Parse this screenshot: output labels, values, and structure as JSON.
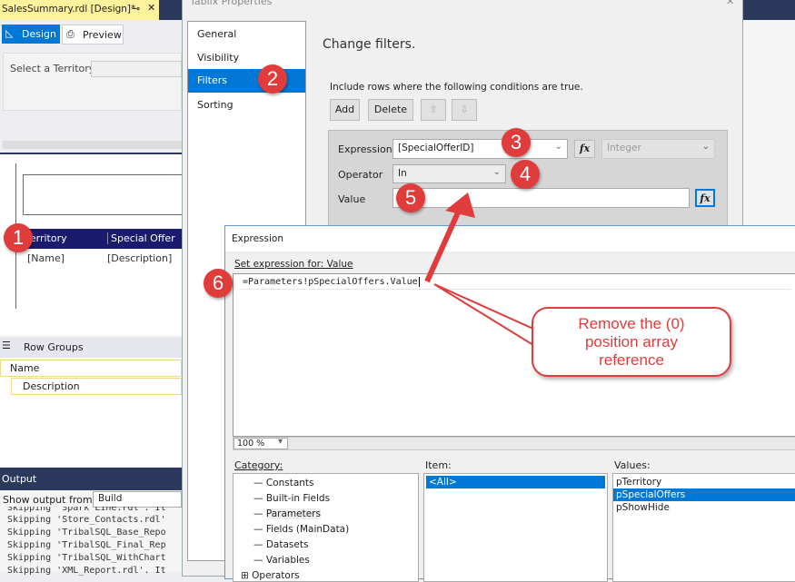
{
  "vs": {
    "doc_tab": "SalesSummary.rdl [Design]*",
    "design_tab": "Design",
    "preview_tab": "Preview",
    "param_label": "Select a Territory",
    "table": {
      "headers": [
        "Territory",
        "Special Offer"
      ],
      "cells": [
        "[Name]",
        "[Description]"
      ]
    },
    "row_groups": {
      "title": "Row Groups",
      "items": [
        "Name",
        "Description"
      ]
    },
    "output": {
      "title": "Output",
      "show_from_label": "Show output from:",
      "show_from_value": "Build",
      "lines": [
        "Skipping 'Spark Line.rdl'. It",
        "Skipping 'Store_Contacts.rdl'",
        "Skipping 'TribalSQL_Base_Repo",
        "Skipping 'TribalSQL_Final_Rep",
        "Skipping 'TribalSQL_WithChart",
        "Skipping 'XML_Report.rdl'. It"
      ]
    }
  },
  "tablix": {
    "title": "Tablix Properties",
    "nav": [
      "General",
      "Visibility",
      "Filters",
      "Sorting"
    ],
    "heading": "Change filters.",
    "instruction": "Include rows where the following conditions are true.",
    "add": "Add",
    "delete": "Delete",
    "expression_label": "Expression",
    "expression_value": "[SpecialOfferID]",
    "type_value": "Integer",
    "operator_label": "Operator",
    "operator_value": "In",
    "value_label": "Value",
    "value_value": "",
    "fx": "fx"
  },
  "expr": {
    "title": "Expression",
    "set_label": "Set expression for: Value",
    "code": "=Parameters!pSpecialOffers.Value",
    "zoom": "100 %",
    "category_label": "Category:",
    "item_label": "Item:",
    "values_label": "Values:",
    "categories": [
      "Constants",
      "Built-in Fields",
      "Parameters",
      "Fields (MainData)",
      "Datasets",
      "Variables",
      "Operators"
    ],
    "items": [
      "<All>"
    ],
    "values": [
      "pTerritory",
      "pSpecialOffers",
      "pShowHide"
    ]
  },
  "callout": "Remove the (0) position array reference",
  "badges": [
    "1",
    "2",
    "3",
    "4",
    "5",
    "6"
  ],
  "colors": {
    "accent": "#0078d7",
    "annotation": "#e03c3c",
    "navy": "#1b1b6e"
  }
}
